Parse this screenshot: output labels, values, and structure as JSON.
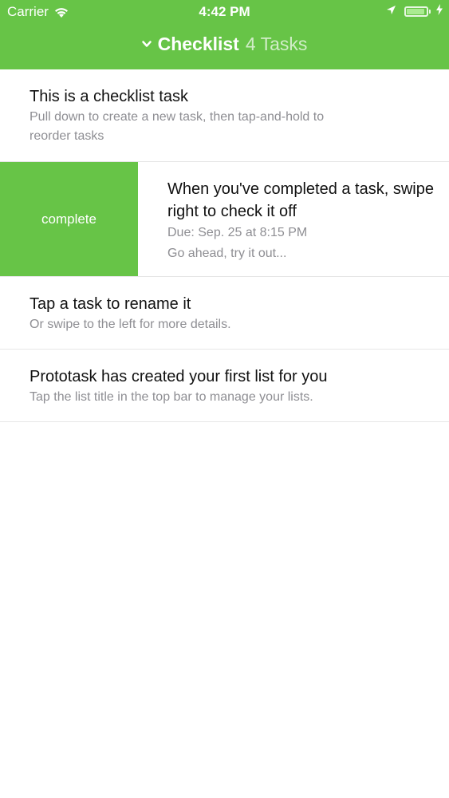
{
  "status_bar": {
    "carrier": "Carrier",
    "time": "4:42 PM",
    "icons": [
      "wifi-icon",
      "location-icon",
      "battery-icon",
      "charging-icon"
    ]
  },
  "nav": {
    "list_name": "Checklist",
    "task_count": "4 Tasks",
    "icon": "chevron-down-icon"
  },
  "colors": {
    "accent": "#67c447",
    "subtitle": "#8e8e93",
    "title": "#111111"
  },
  "tasks": [
    {
      "title": "This is a checklist task",
      "subtitle_lines": [
        "Pull down to create a new task, then tap-and-hold to",
        "reorder tasks"
      ]
    },
    {
      "swipe_action": "complete",
      "title_lines": [
        "When you've completed a task, swipe",
        "right to check it off"
      ],
      "due": "Due: Sep. 25 at 8:15 PM",
      "subtitle": "Go ahead, try it out..."
    },
    {
      "title": "Tap a task to rename it",
      "subtitle": "Or swipe to the left for more details."
    },
    {
      "title": "Prototask has created your first list for you",
      "subtitle": "Tap the list title in the top bar to manage your lists."
    }
  ]
}
